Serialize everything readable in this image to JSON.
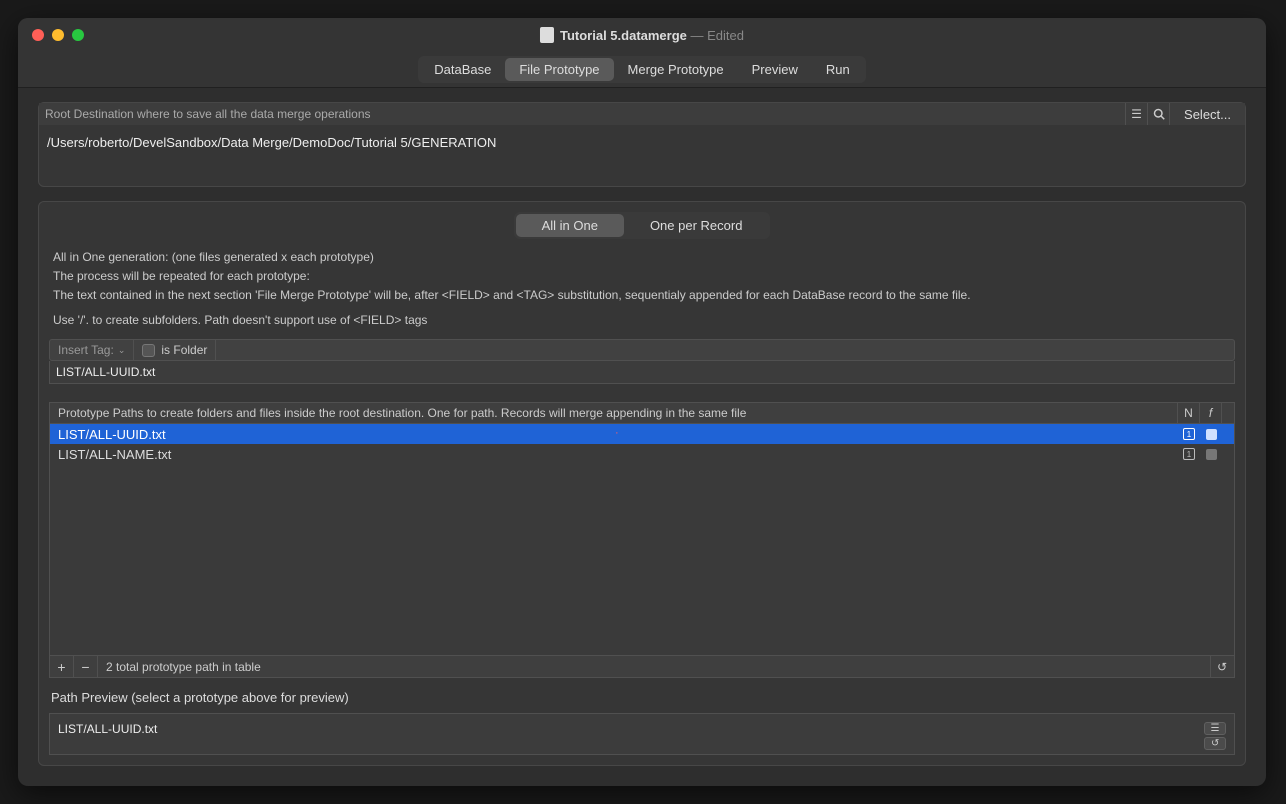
{
  "window": {
    "title": "Tutorial 5.datamerge",
    "edited_suffix": "— Edited"
  },
  "toolbar": {
    "tabs": [
      "DataBase",
      "File Prototype",
      "Merge Prototype",
      "Preview",
      "Run"
    ],
    "active_index": 1
  },
  "destination": {
    "label": "Root Destination where to save all the data merge operations",
    "select_label": "Select...",
    "path": "/Users/roberto/DevelSandbox/Data Merge/DemoDoc/Tutorial 5/GENERATION"
  },
  "mode": {
    "options": [
      "All in One",
      "One per Record"
    ],
    "active_index": 0
  },
  "help": {
    "line1": "All in One generation: (one files generated x each prototype)",
    "line2": "The process will be repeated for each prototype:",
    "line3": "The text contained in the next section 'File Merge Prototype' will be, after <FIELD> and <TAG> substitution, sequentialy appended for each DataBase record to the same file.",
    "line4": "Use '/'. to create subfolders. Path doesn't support use of <FIELD> tags"
  },
  "insert": {
    "tag_label": "Insert Tag:",
    "is_folder_label": "is Folder",
    "input_value": "LIST/ALL-UUID.txt"
  },
  "table": {
    "header_main": "Prototype Paths to create folders and  files inside the root destination. One for path. Records will merge appending in the same file",
    "header_n": "N",
    "header_f": "f",
    "rows": [
      {
        "path": "LIST/ALL-UUID.txt",
        "n_icon": "1",
        "selected": true,
        "marker": "·"
      },
      {
        "path": "LIST/ALL-NAME.txt",
        "n_icon": "1",
        "selected": false,
        "marker": ""
      }
    ],
    "footer_count": "2 total prototype path in table"
  },
  "preview": {
    "label": "Path Preview (select a prototype above for preview)",
    "value": "LIST/ALL-UUID.txt"
  }
}
